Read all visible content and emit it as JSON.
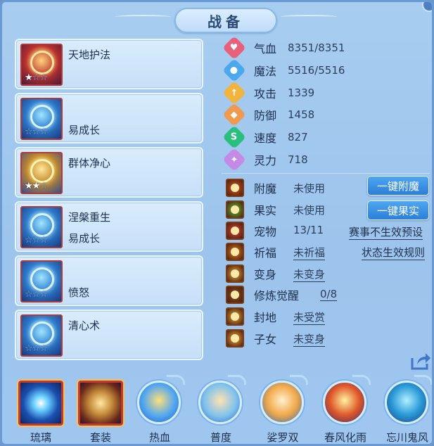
{
  "title": "战备",
  "colors": {
    "panel_bg": "#a7cdf0",
    "accent_blue": "#2b7fd8",
    "text_dark": "#1e2f4e"
  },
  "skills": [
    {
      "name": "天地护法",
      "subtitle": "",
      "stars": 1,
      "icon": "golden-snake-icon",
      "tone": "red"
    },
    {
      "name": "",
      "subtitle": "易成长",
      "stars": 0,
      "icon": "blue-beast-icon",
      "tone": "blue"
    },
    {
      "name": "群体净心",
      "subtitle": "",
      "stars": 2,
      "icon": "golden-armor-icon",
      "tone": "gold"
    },
    {
      "name": "涅槃重生",
      "subtitle": "易成长",
      "stars": 0,
      "icon": "blue-serpent-icon",
      "tone": "blue"
    },
    {
      "name": "",
      "subtitle": "愤怒",
      "stars": 0,
      "icon": "blue-crown-icon",
      "tone": "blue"
    },
    {
      "name": "清心术",
      "subtitle": "",
      "stars": 0,
      "icon": "blue-fist-icon",
      "tone": "blue"
    }
  ],
  "stats": [
    {
      "label": "气血",
      "value": "8351/8351",
      "icon": "heart-icon",
      "color": "#e8607a"
    },
    {
      "label": "魔法",
      "value": "5516/5516",
      "icon": "mana-drop-icon",
      "color": "#4aa8ee"
    },
    {
      "label": "攻击",
      "value": "1339",
      "icon": "sword-icon",
      "color": "#f2b43c"
    },
    {
      "label": "防御",
      "value": "1458",
      "icon": "shield-icon",
      "color": "#f09a50"
    },
    {
      "label": "速度",
      "value": "827",
      "icon": "lightning-icon",
      "color": "#2bbf7e"
    },
    {
      "label": "灵力",
      "value": "718",
      "icon": "spirit-icon",
      "color": "#c58ae6"
    }
  ],
  "equipment": [
    {
      "label": "附魔",
      "value": "未使用",
      "link": false,
      "icon": "enchant-icon",
      "color": "#d9541f"
    },
    {
      "label": "果实",
      "value": "未使用",
      "link": false,
      "icon": "fruit-icon",
      "color": "#5fbf3a"
    },
    {
      "label": "宠物",
      "value": "13/11",
      "link": false,
      "icon": "pet-portrait-icon",
      "color": "#d9433a"
    },
    {
      "label": "祈福",
      "value": "未祈福",
      "link": true,
      "icon": "blessing-icon",
      "color": "#e07a20"
    },
    {
      "label": "变身",
      "value": "未变身",
      "link": true,
      "icon": "transform-icon",
      "color": "#e6a23c"
    },
    {
      "label": "修炼觉醒",
      "value": "0/8",
      "link": true,
      "icon": "cultivation-icon",
      "color": "#8a4a24"
    },
    {
      "label": "封地",
      "value": "未受赏",
      "link": true,
      "icon": "fief-icon",
      "color": "#e0a53a"
    },
    {
      "label": "子女",
      "value": "未变身",
      "link": true,
      "icon": "children-icon",
      "color": "#f2a03c"
    }
  ],
  "buttons": {
    "enchant": "一键附魔",
    "fruit": "一键果实"
  },
  "links": {
    "event_preset": "赛事不生效预设",
    "status_rules": "状态生效规则"
  },
  "tabs": [
    {
      "label": "琉璃",
      "selected": true,
      "style": "square",
      "icon": "glass-orb-icon"
    },
    {
      "label": "套装",
      "selected": true,
      "style": "square",
      "icon": "treasure-icon"
    },
    {
      "label": "热血",
      "selected": false,
      "style": "circle",
      "icon": "warrior-icon"
    },
    {
      "label": "普度",
      "selected": false,
      "style": "circle",
      "icon": "palm-icon"
    },
    {
      "label": "娑罗双",
      "selected": false,
      "style": "circle",
      "icon": "hand-icon"
    },
    {
      "label": "春风化雨",
      "selected": false,
      "style": "circle",
      "icon": "flame-orb-icon"
    },
    {
      "label": "忘川鬼风",
      "selected": false,
      "style": "circle",
      "icon": "ghost-wind-icon"
    }
  ]
}
